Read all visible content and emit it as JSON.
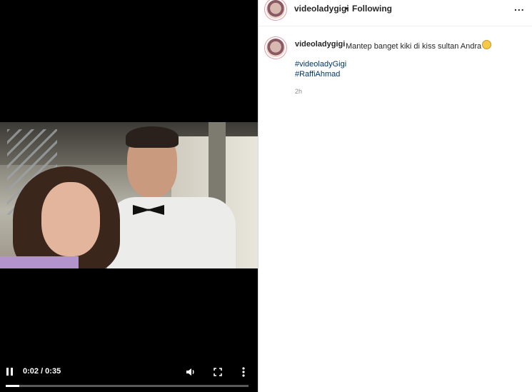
{
  "video": {
    "time_label": "0:02 / 0:35",
    "progress": 0.057,
    "controls": {
      "pause_icon": "pause-icon",
      "volume_icon": "volume-icon",
      "fullscreen_icon": "fullscreen-icon",
      "more_icon": "more-vertical-icon"
    }
  },
  "header": {
    "username": "videoladygigi",
    "separator": "•",
    "follow_status": "Following",
    "more_label": "..."
  },
  "caption": {
    "username": "videoladygigi",
    "text": "Mantep banget kiki di kiss sultan Andra",
    "emoji": "grinning-face-emoji",
    "hashtags": [
      "#videoladyGigi",
      "#RaffiAhmad"
    ],
    "timestamp": "2h"
  },
  "colors": {
    "link": "#00376b",
    "text": "#262626",
    "muted": "#8e8e8e",
    "video_background": "#000000"
  }
}
